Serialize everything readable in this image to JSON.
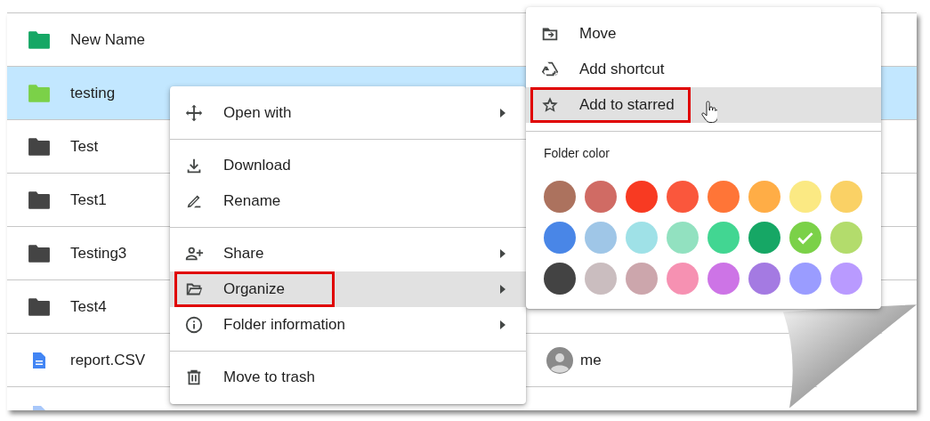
{
  "files": [
    {
      "name": "New Name",
      "kind": "folder",
      "color": "#16a765",
      "selected": false
    },
    {
      "name": "testing",
      "kind": "folder",
      "color": "#7bd148",
      "selected": true
    },
    {
      "name": "Test",
      "kind": "folder",
      "color": "#444444",
      "selected": false
    },
    {
      "name": "Test1",
      "kind": "folder",
      "color": "#444444",
      "selected": false
    },
    {
      "name": "Testing3",
      "kind": "folder",
      "color": "#444444",
      "selected": false
    },
    {
      "name": "Test4",
      "kind": "folder",
      "color": "#444444",
      "selected": false
    },
    {
      "name": "report.CSV",
      "kind": "doc",
      "color": "#4285f4",
      "selected": false,
      "owner": "me"
    },
    {
      "kind": "doc",
      "color": "#a8c7fa",
      "selected": false
    }
  ],
  "context_menu": {
    "groups": [
      [
        {
          "label": "Open with",
          "kind": "open-with",
          "submenu": true,
          "selected": false,
          "outlined": false
        }
      ],
      [
        {
          "label": "Download",
          "kind": "download",
          "submenu": false,
          "selected": false,
          "outlined": false
        },
        {
          "label": "Rename",
          "kind": "rename",
          "submenu": false,
          "selected": false,
          "outlined": false
        }
      ],
      [
        {
          "label": "Share",
          "kind": "share",
          "submenu": true,
          "selected": false,
          "outlined": false
        },
        {
          "label": "Organize",
          "kind": "organize",
          "submenu": true,
          "selected": true,
          "outlined": true
        },
        {
          "label": "Folder information",
          "kind": "info",
          "submenu": true,
          "selected": false,
          "outlined": false
        }
      ],
      [
        {
          "label": "Move to trash",
          "kind": "trash",
          "submenu": false,
          "selected": false,
          "outlined": false
        }
      ]
    ]
  },
  "organize_menu": {
    "items": [
      {
        "label": "Move",
        "kind": "move",
        "selected": false,
        "outlined": false
      },
      {
        "label": "Add shortcut",
        "kind": "shortcut",
        "selected": false,
        "outlined": false
      },
      {
        "label": "Add to starred",
        "kind": "star",
        "selected": true,
        "outlined": true
      }
    ],
    "folder_color": {
      "label": "Folder color",
      "swatches": [
        {
          "color": "#ac725e",
          "checked": false
        },
        {
          "color": "#d06b64",
          "checked": false
        },
        {
          "color": "#f83a22",
          "checked": false
        },
        {
          "color": "#fa573c",
          "checked": false
        },
        {
          "color": "#ff7537",
          "checked": false
        },
        {
          "color": "#ffad46",
          "checked": false
        },
        {
          "color": "#fbe983",
          "checked": false
        },
        {
          "color": "#fad165",
          "checked": false
        },
        {
          "color": "#4986e7",
          "checked": false
        },
        {
          "color": "#9fc6e7",
          "checked": false
        },
        {
          "color": "#9fe1e7",
          "checked": false
        },
        {
          "color": "#92e1c0",
          "checked": false
        },
        {
          "color": "#42d692",
          "checked": false
        },
        {
          "color": "#16a765",
          "checked": false
        },
        {
          "color": "#7bd148",
          "checked": true
        },
        {
          "color": "#b3dc6c",
          "checked": false
        },
        {
          "color": "#434343",
          "checked": false
        },
        {
          "color": "#cabdbf",
          "checked": false
        },
        {
          "color": "#cca6ac",
          "checked": false
        },
        {
          "color": "#f691b2",
          "checked": false
        },
        {
          "color": "#cd74e6",
          "checked": false
        },
        {
          "color": "#a47ae2",
          "checked": false
        },
        {
          "color": "#9a9cff",
          "checked": false
        },
        {
          "color": "#b99aff",
          "checked": false
        }
      ]
    }
  }
}
